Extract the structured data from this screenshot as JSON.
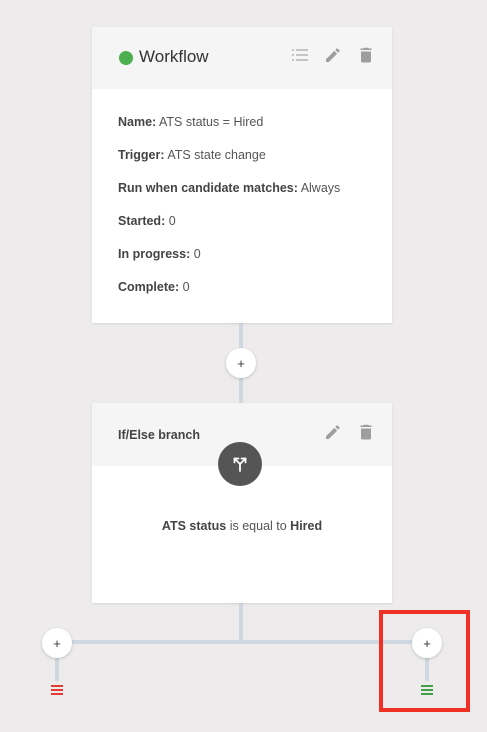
{
  "workflow": {
    "title": "Workflow",
    "status_color": "#4caf50",
    "header_icons": [
      "list-icon",
      "pencil-icon",
      "trash-icon"
    ],
    "rows": [
      {
        "label": "Name:",
        "value": " ATS status = Hired"
      },
      {
        "label": "Trigger:",
        "value": " ATS state change"
      },
      {
        "label": "Run when candidate matches:",
        "value": " Always"
      },
      {
        "label": "Started:",
        "value": " 0"
      },
      {
        "label": "In progress:",
        "value": " 0"
      },
      {
        "label": "Complete:",
        "value": " 0"
      }
    ]
  },
  "add_step": {
    "label": "+"
  },
  "branch": {
    "title": "If/Else branch",
    "icon": "split-branch-icon",
    "header_icons": [
      "pencil-icon",
      "trash-icon"
    ],
    "condition": {
      "field": "ATS status",
      "operator": " is equal to ",
      "value": "Hired"
    }
  },
  "left_branch": {
    "add_label": "+",
    "end_icon": "end-icon",
    "end_color": "#e53935"
  },
  "right_branch": {
    "add_label": "+",
    "end_icon": "end-icon",
    "end_color": "#43a047",
    "highlight_color": "#ee3124"
  }
}
